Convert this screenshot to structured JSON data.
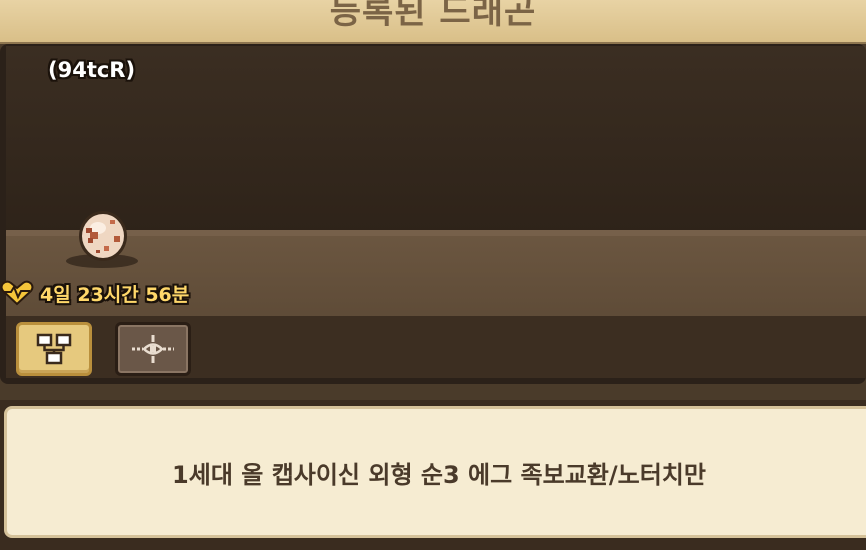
{
  "header": {
    "title": "등록된 드래곤"
  },
  "dragon": {
    "code": "(94tcR)",
    "timer": "4일 23시간 56분",
    "egg_icon": "egg-icon",
    "timer_icon": "heart-icon"
  },
  "actions": {
    "family_tree_icon": "family-tree-icon",
    "target_icon": "crosshair-icon"
  },
  "description": {
    "text": "1세대 올 캡사이신 외형 순3 에그 족보교환/노터치만"
  },
  "colors": {
    "header_bg": "#e8d3a4",
    "panel_bg": "#2b2119",
    "timer_text": "#ffd86a",
    "active_button": "#e6c97e",
    "description_bg": "#f6ecd2"
  }
}
